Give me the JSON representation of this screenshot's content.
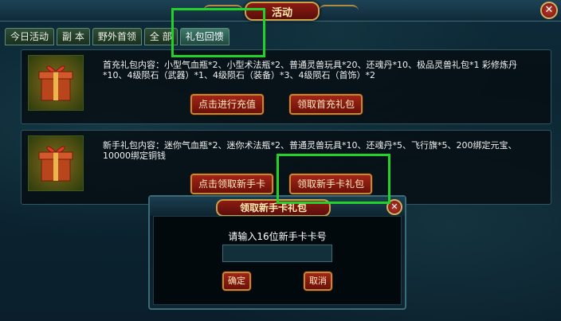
{
  "window": {
    "title": "活动",
    "close_label": "✕"
  },
  "tabs": [
    {
      "label": "今日活动"
    },
    {
      "label": "副 本"
    },
    {
      "label": "野外首领"
    },
    {
      "label": "全 部"
    },
    {
      "label": "礼包回馈",
      "active": true
    }
  ],
  "panels": [
    {
      "description": "首充礼包内容：小型气血瓶*2、小型术法瓶*2、普通灵兽玩具*20、还魂丹*10、极品灵兽礼包*1 彩修炼丹*10、4级陨石（武器）*1、4级陨石（装备）*3、4级陨石（首饰）*2",
      "buttons": [
        "点击进行充值",
        "领取首充礼包"
      ]
    },
    {
      "description": "新手礼包内容：迷你气血瓶*2、迷你术法瓶*2、普通灵兽玩具*10、还魂丹*5、飞行旗*5、200绑定元宝、10000绑定铜钱",
      "buttons": [
        "点击领取新手卡",
        "领取新手卡礼包"
      ]
    }
  ],
  "dialog": {
    "title": "领取新手卡礼包",
    "prompt": "请输入16位新手卡卡号",
    "input_value": "",
    "confirm_label": "确定",
    "cancel_label": "取消",
    "close_label": "✕"
  },
  "colors": {
    "highlight": "#22d12a",
    "button_red": "#a12516",
    "gold_border": "#c9a34c"
  },
  "icons": [
    "close-icon",
    "gift-box-icon"
  ]
}
